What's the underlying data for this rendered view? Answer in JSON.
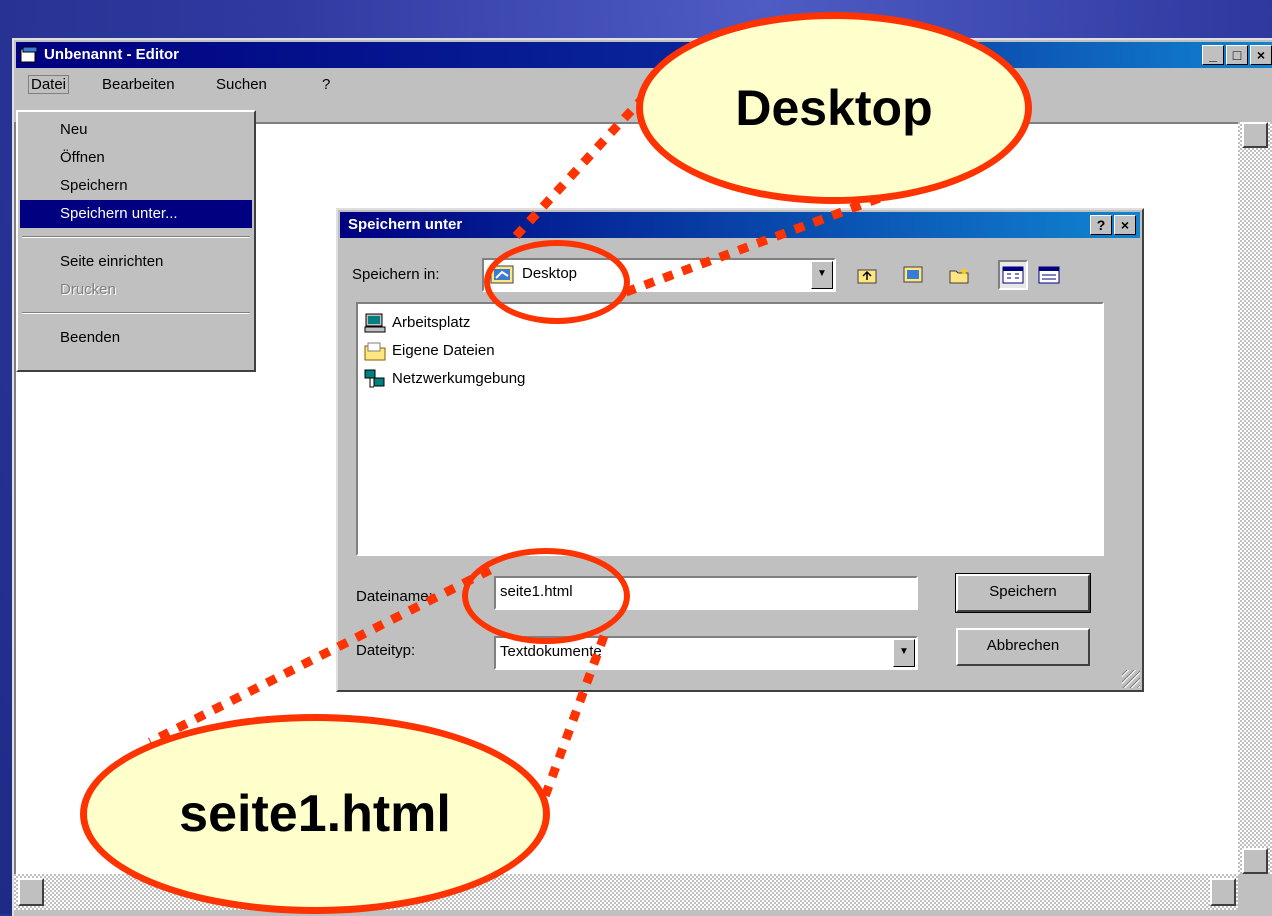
{
  "window": {
    "title": "Unbenannt - Editor",
    "buttons": {
      "minimize": "_",
      "maximize": "□",
      "close": "×"
    }
  },
  "menubar": {
    "items": [
      {
        "label": "Datei"
      },
      {
        "label": "Bearbeiten"
      },
      {
        "label": "Suchen"
      },
      {
        "label": "?"
      }
    ]
  },
  "file_menu": {
    "items": [
      {
        "label": "Neu",
        "state": "normal"
      },
      {
        "label": "Öffnen",
        "state": "normal"
      },
      {
        "label": "Speichern",
        "state": "normal"
      },
      {
        "label": "Speichern unter...",
        "state": "selected"
      },
      {
        "label": "Seite einrichten",
        "state": "normal"
      },
      {
        "label": "Drucken",
        "state": "disabled"
      },
      {
        "label": "Beenden",
        "state": "normal"
      }
    ]
  },
  "dialog": {
    "title": "Speichern unter",
    "help_button": "?",
    "close_button": "×",
    "save_in_label": "Speichern in:",
    "save_in_value": "Desktop",
    "files": [
      {
        "name": "Arbeitsplatz",
        "icon": "computer-icon"
      },
      {
        "name": "Eigene Dateien",
        "icon": "folder-icon"
      },
      {
        "name": "Netzwerkumgebung",
        "icon": "network-icon"
      }
    ],
    "filename_label": "Dateiname:",
    "filename_value": "seite1.html",
    "filetype_label": "Dateityp:",
    "filetype_value": "Textdokumente",
    "save_button": "Speichern",
    "cancel_button": "Abbrechen"
  },
  "annotations": {
    "top": "Desktop",
    "bottom": "seite1.html"
  },
  "colors": {
    "annotation_red": "#ff3300",
    "annotation_fill": "#ffffcc",
    "titlebar_blue": "#000080",
    "background_blue": "#2e3aa0"
  }
}
